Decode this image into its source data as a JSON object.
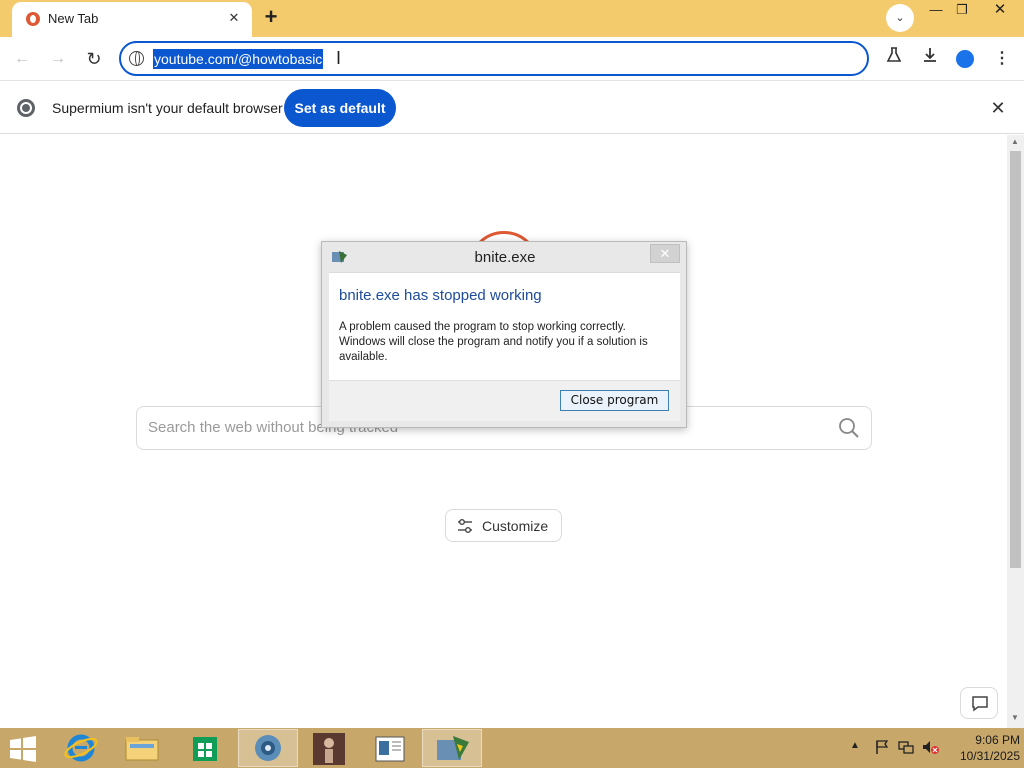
{
  "browser": {
    "tab_title": "New Tab",
    "tab_close_glyph": "✕",
    "new_tab_glyph": "+",
    "tab_search_glyph": "⌄",
    "window_min_glyph": "—",
    "window_max_glyph": "❐",
    "window_close_glyph": "✕"
  },
  "toolbar": {
    "back_glyph": "←",
    "forward_glyph": "→",
    "reload_glyph": "↻",
    "url": "youtube.com/@howtobasic",
    "cursor_glyph": "I",
    "menu_glyph": "⋮"
  },
  "infobar": {
    "message": "Supermium isn't your default browser",
    "button_label": "Set as default",
    "close_glyph": "✕"
  },
  "page": {
    "search_placeholder": "Search the web without being tracked",
    "customize_label": "Customize"
  },
  "dialog": {
    "title": "bnite.exe",
    "heading": "bnite.exe has stopped working",
    "message": "A problem caused the program to stop working correctly. Windows will close the program and notify you if a solution is available.",
    "button_label": "Close program",
    "close_glyph": "✕"
  },
  "taskbar": {
    "time": "9:06 PM",
    "date": "10/31/2025",
    "tray_up_glyph": "▲"
  },
  "colors": {
    "titlebar": "#f4cb6c",
    "accent": "#0b57d0",
    "taskbar": "#c8a86a",
    "logo": "#de5833",
    "dialog_heading": "#1e4b9c"
  },
  "icons": [
    "duckduckgo-favicon",
    "site-info-icon",
    "labs-icon",
    "download-icon",
    "profile-icon",
    "menu-icon",
    "chromium-icon",
    "search-icon",
    "customize-icon",
    "feedback-icon",
    "windows-start-icon",
    "internet-explorer-icon",
    "file-explorer-icon",
    "store-icon"
  ]
}
